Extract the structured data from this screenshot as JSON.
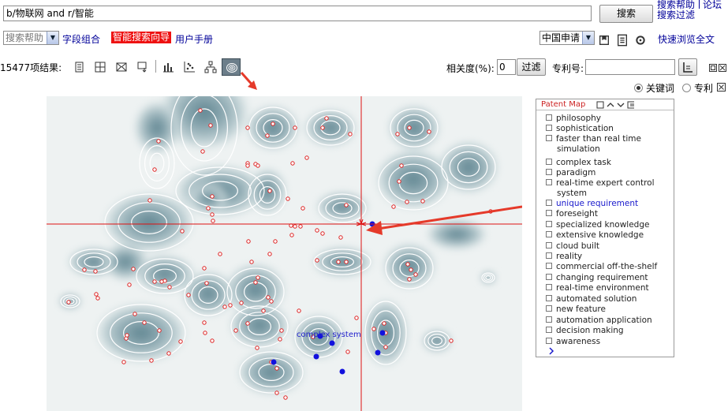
{
  "search": {
    "query": "b/物联网 and r/智能",
    "button": "搜索",
    "help_link": "搜索帮助",
    "forum_link": "论坛",
    "filter_link": "搜索过滤"
  },
  "options": {
    "help_select": "搜索帮助",
    "field_combo": "字段组合",
    "smart_guide": "智能搜索向导",
    "manual": "用户手册",
    "country_select": "中国申请",
    "quick_browse": "快速浏览全文"
  },
  "results": {
    "count_label": "15477项结果:",
    "relevance_label": "相关度(%):",
    "relevance_value": "0",
    "filter_button": "过滤",
    "patent_no_label": "专利号:",
    "patent_no_value": ""
  },
  "mode": {
    "keyword_label": "关键词",
    "patent_label": "专利",
    "selected": "关键词"
  },
  "map": {
    "cluster_label": "complex system",
    "crosshair_color": "#dd1111",
    "point_color": "#dd2222",
    "selected_point_color": "#1111dd"
  },
  "panel": {
    "title": "Patent Map",
    "terms": [
      "philosophy",
      "sophistication",
      "faster than real time simulation",
      "complex task",
      "paradigm",
      "real-time expert control system",
      "unique requirement",
      "foreseight",
      "specialized knowledge",
      "extensive knowledge",
      "cloud built",
      "reality",
      "commercial off-the-shelf",
      "changing requirement",
      "real-time environment",
      "automated solution",
      "new feature",
      "automation application",
      "decision making",
      "awareness"
    ],
    "active_term": "unique requirement"
  },
  "icons": [
    "list-view-icon",
    "grid-view-icon",
    "email-icon",
    "export-icon",
    "bar-chart-icon",
    "scatter-chart-icon",
    "tree-icon",
    "patent-map-icon",
    "chart-settings-icon",
    "collapse-icon",
    "close-icon"
  ]
}
